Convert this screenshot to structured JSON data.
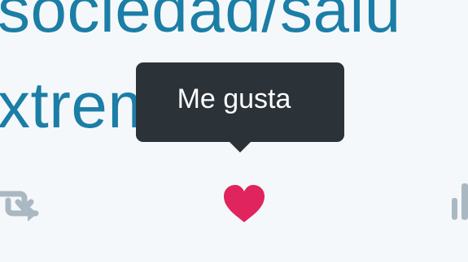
{
  "tweet": {
    "link_line_1": "sociedad/salu",
    "link_line_2": "xtremadura"
  },
  "tooltip": {
    "text": "Me gusta"
  },
  "actions": {
    "retweet_icon": "retweet-icon",
    "like_icon": "heart-icon",
    "stats_icon": "bar-chart-icon"
  },
  "colors": {
    "background": "#f5f8fa",
    "link": "#1b7ea6",
    "tooltip_bg": "#2b3238",
    "tooltip_text": "#ffffff",
    "heart": "#e0245e",
    "icon_gray": "#aab8c2"
  }
}
